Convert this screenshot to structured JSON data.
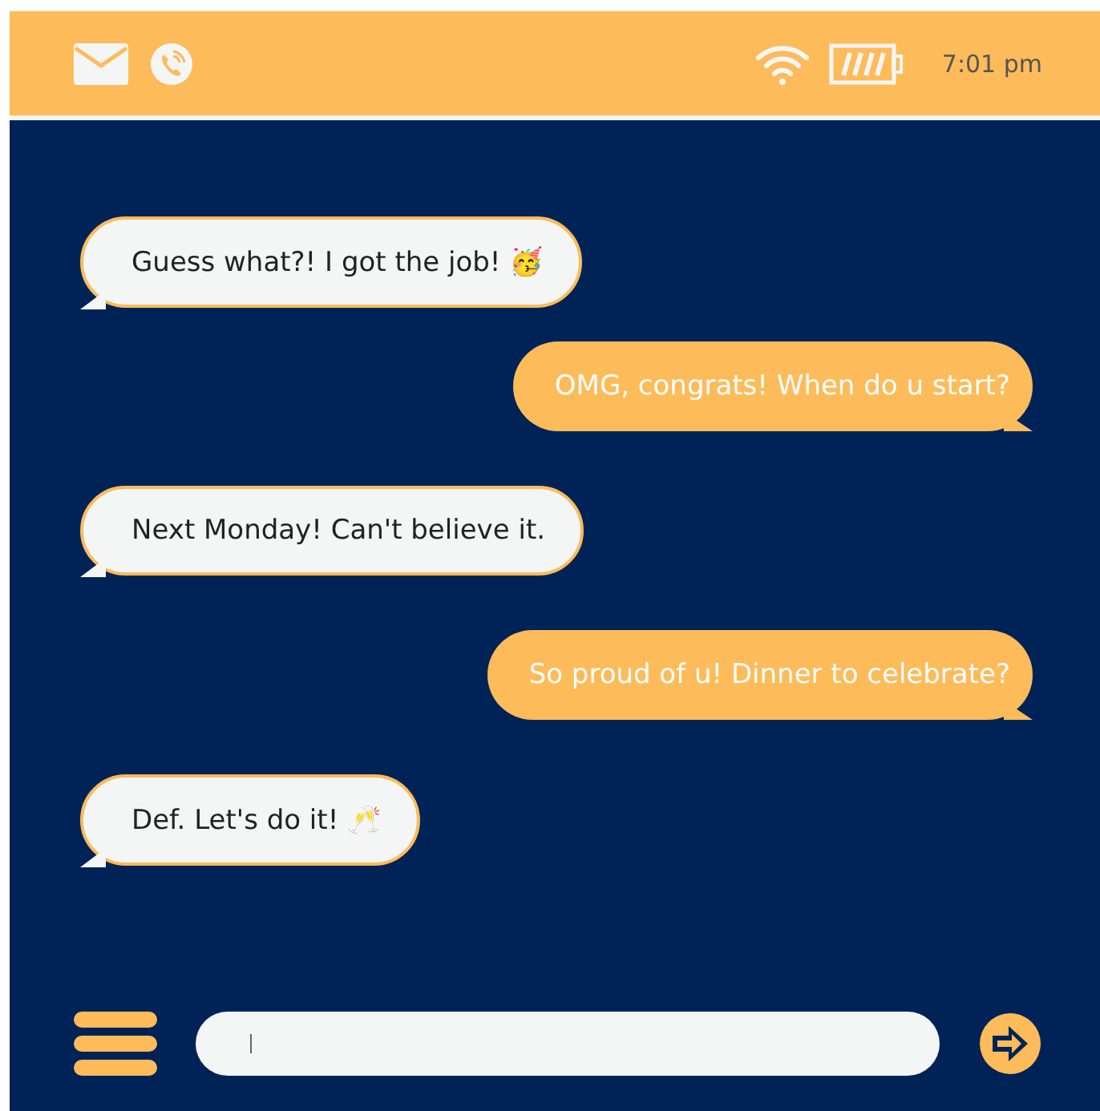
{
  "status_bar": {
    "time": "7:01 pm"
  },
  "messages": [
    {
      "kind": "incoming",
      "text": "Guess what?! I got the job! 🥳"
    },
    {
      "kind": "outgoing",
      "text": "OMG, congrats! When do u start?"
    },
    {
      "kind": "incoming",
      "text": "Next Monday! Can't believe it."
    },
    {
      "kind": "outgoing",
      "text": "So proud of u! Dinner to celebrate?"
    },
    {
      "kind": "incoming",
      "text": "Def. Let's do it! 🥂"
    }
  ]
}
